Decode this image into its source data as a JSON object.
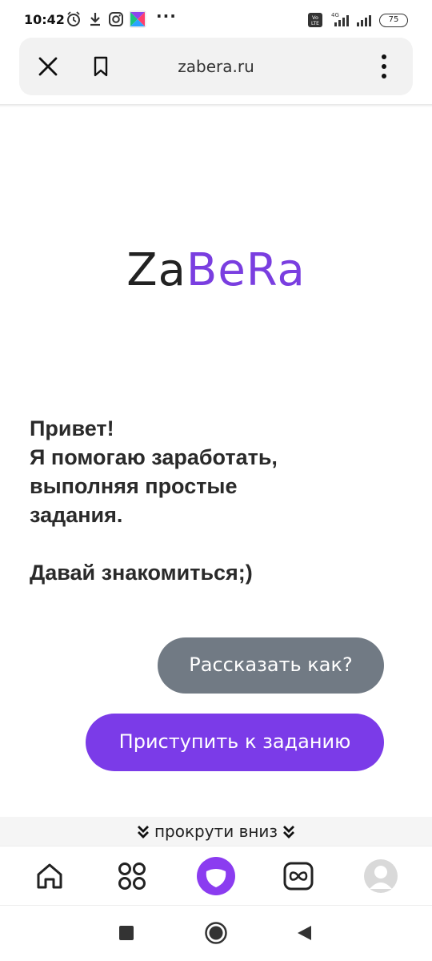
{
  "status_bar": {
    "time": "10:42",
    "more": "···",
    "battery": "75",
    "icons": [
      "alarm-icon",
      "download-icon",
      "instagram-icon",
      "app-icon",
      "volte-icon",
      "signal-4g-icon",
      "signal-icon",
      "battery-icon"
    ]
  },
  "browser": {
    "url": "zabera.ru",
    "icons": [
      "close-icon",
      "bookmark-icon",
      "more-vertical-icon"
    ]
  },
  "logo": {
    "part1": "Za",
    "part2": "BeRa",
    "color_dark": "#222222",
    "color_accent": "#7a3ee0"
  },
  "intro": {
    "lines": [
      "Привет!",
      "Я помогаю заработать,",
      "выполняя простые",
      "задания."
    ],
    "cta": "Давай знакомиться;)"
  },
  "buttons": {
    "how_label": "Рассказать как?",
    "how_color": "#717a84",
    "start_label": "Приступить к заданию",
    "start_color": "#7b3be8"
  },
  "scroll_hint": {
    "label": "прокрути вниз"
  },
  "bottom_nav": {
    "items": [
      "home-icon",
      "apps-grid-icon",
      "alice-icon",
      "infinity-icon",
      "profile-avatar-icon"
    ]
  },
  "system_nav": {
    "items": [
      "recents-square-icon",
      "home-circle-icon",
      "back-triangle-icon"
    ]
  }
}
